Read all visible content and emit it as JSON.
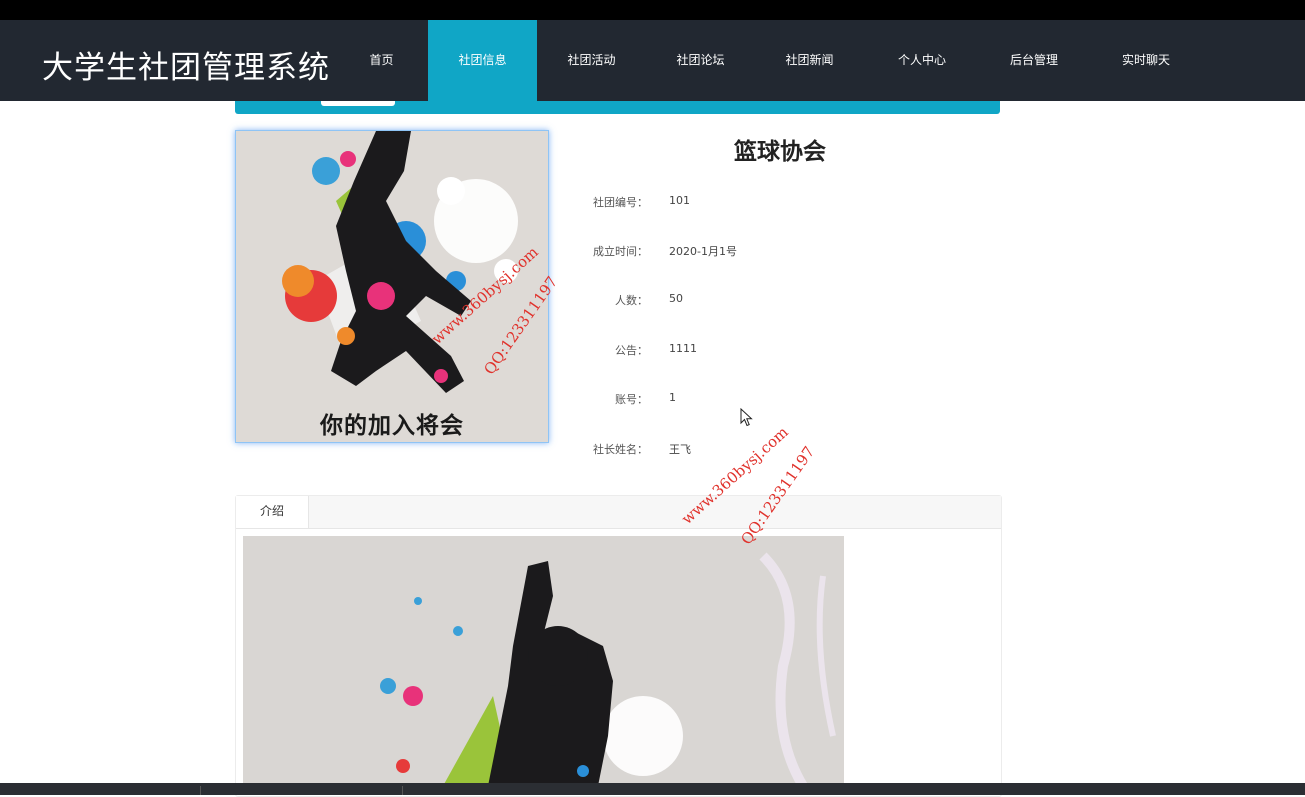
{
  "brand": {
    "title": "大学生社团管理系统"
  },
  "nav": {
    "items": [
      {
        "label": "首页"
      },
      {
        "label": "社团信息"
      },
      {
        "label": "社团活动"
      },
      {
        "label": "社团论坛"
      },
      {
        "label": "社团新闻"
      },
      {
        "label": "个人中心"
      },
      {
        "label": "后台管理"
      },
      {
        "label": "实时聊天"
      }
    ],
    "active_label": "社团信息"
  },
  "cover": {
    "caption": "你的加入将会"
  },
  "club": {
    "name": "篮球协会",
    "fields": [
      {
        "label": "社团编号：",
        "value": "101"
      },
      {
        "label": "成立时间：",
        "value": "2020-1月1号"
      },
      {
        "label": "人数：",
        "value": "50"
      },
      {
        "label": "公告：",
        "value": "1111"
      },
      {
        "label": "账号：",
        "value": "1"
      },
      {
        "label": "社长姓名：",
        "value": "王飞"
      }
    ]
  },
  "tabs": {
    "intro_label": "介绍"
  },
  "watermarks": [
    {
      "site": "www.360bysj.com",
      "qq": "QQ:123311197"
    },
    {
      "site": "www.360bysj.com",
      "qq": "QQ:123311197"
    }
  ],
  "colors": {
    "nav_bg": "#222831",
    "accent": "#10a6c6",
    "watermark": "#e0322c"
  }
}
